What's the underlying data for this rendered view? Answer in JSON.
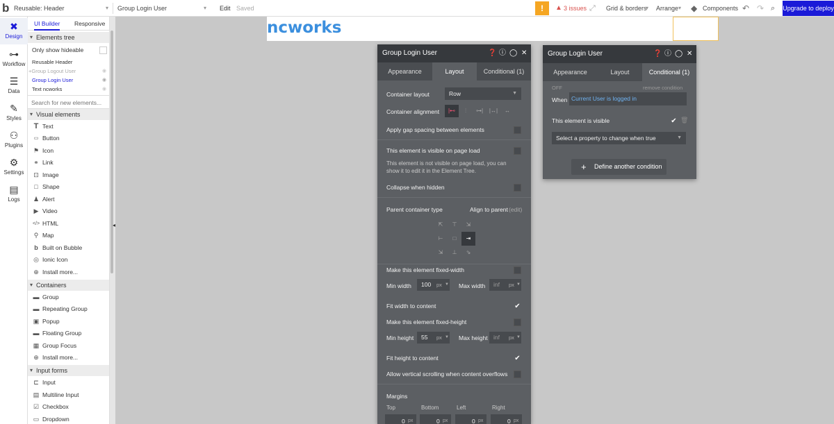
{
  "topbar": {
    "logo": "b",
    "page_selector": "Reusable: Header",
    "element_selector": "Group Login User",
    "edit": "Edit",
    "saved": "Saved",
    "warn_icon": "!",
    "issues": "3 issues",
    "grid_borders": "Grid & borders",
    "arrange": "Arrange",
    "components": "Components",
    "upgrade": "Upgrade to deploy",
    "accent": "#1a1ad8"
  },
  "nav": [
    {
      "label": "Design",
      "icon": "design-icon"
    },
    {
      "label": "Workflow",
      "icon": "workflow-icon"
    },
    {
      "label": "Data",
      "icon": "data-icon"
    },
    {
      "label": "Styles",
      "icon": "styles-icon"
    },
    {
      "label": "Plugins",
      "icon": "plugins-icon"
    },
    {
      "label": "Settings",
      "icon": "settings-icon"
    },
    {
      "label": "Logs",
      "icon": "logs-icon"
    }
  ],
  "tree": {
    "tab_builder": "UI Builder",
    "tab_responsive": "Responsive",
    "elements_tree": "Elements tree",
    "only_hideable": "Only show hideable",
    "items": [
      "Reusable Header",
      "+Group Logout User",
      "Group Login User",
      "Text ncworks"
    ],
    "search_placeholder": "Search for new elements...",
    "visual_header": "Visual elements",
    "visual": [
      "Text",
      "Button",
      "Icon",
      "Link",
      "Image",
      "Shape",
      "Alert",
      "Video",
      "HTML",
      "Map",
      "Built on Bubble",
      "Ionic Icon",
      "Install more..."
    ],
    "containers_header": "Containers",
    "containers": [
      "Group",
      "Repeating Group",
      "Popup",
      "Floating Group",
      "Group Focus",
      "Install more..."
    ],
    "inputs_header": "Input forms",
    "inputs": [
      "Input",
      "Multiline Input",
      "Checkbox",
      "Dropdown"
    ]
  },
  "canvas": {
    "title": "ncworks",
    "title_color": "#3b8fde"
  },
  "layout_panel": {
    "title": "Group Login User",
    "tabs": [
      "Appearance",
      "Layout",
      "Conditional (1)"
    ],
    "container_layout_label": "Container layout",
    "container_layout_value": "Row",
    "container_alignment_label": "Container alignment",
    "gap_label": "Apply gap spacing between elements",
    "visible_label": "This element is visible on page load",
    "visible_note1": "This element is not visible on page load, you can",
    "visible_note2": "show it to edit it in the Element Tree.",
    "collapse_label": "Collapse when hidden",
    "parent_type_label": "Parent container type",
    "parent_type_value": "Align to parent",
    "parent_type_edit": "(edit)",
    "fixed_width_label": "Make this element fixed-width",
    "min_width_label": "Min width",
    "min_width_value": "100",
    "unit": "px",
    "max_width_label": "Max width",
    "max_value": "inf",
    "fit_width_label": "Fit width to content",
    "fixed_height_label": "Make this element fixed-height",
    "min_height_label": "Min height",
    "min_height_value": "55",
    "max_height_label": "Max height",
    "fit_height_label": "Fit height to content",
    "scroll_label": "Allow vertical scrolling when content overflows",
    "margins_label": "Margins",
    "margin_names": [
      "Top",
      "Bottom",
      "Left",
      "Right"
    ],
    "margin_value": "0"
  },
  "cond_panel": {
    "title": "Group Login User",
    "tabs": [
      "Appearance",
      "Layout",
      "Conditional (1)"
    ],
    "off": "OFF",
    "remove": "remove condition",
    "when": "When",
    "condition": "Current User is logged in",
    "visible_label": "This element is visible",
    "select_placeholder": "Select a property to change when true",
    "define_plus": "+",
    "define": "Define another condition"
  }
}
